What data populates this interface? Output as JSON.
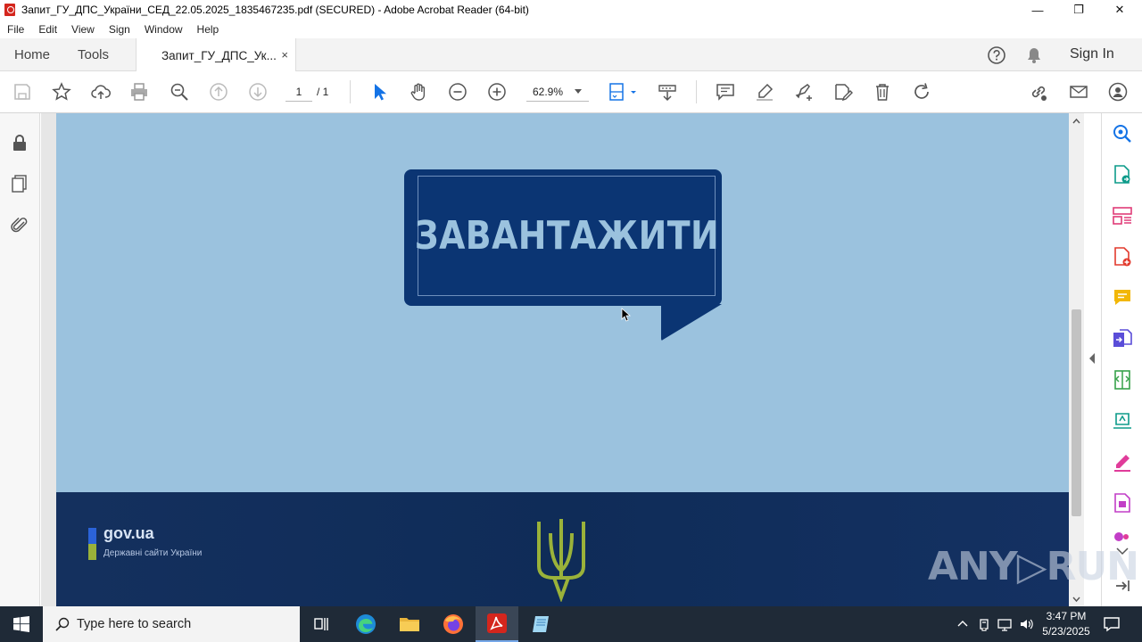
{
  "window": {
    "title": "Запит_ГУ_ДПС_України_СЕД_22.05.2025_1835467235.pdf (SECURED) - Adobe Acrobat Reader (64-bit)",
    "minimize": "—",
    "maximize": "❐",
    "close": "✕"
  },
  "menu": {
    "items": [
      "File",
      "Edit",
      "View",
      "Sign",
      "Window",
      "Help"
    ]
  },
  "tabs": {
    "home": "Home",
    "tools": "Tools",
    "document": "Запит_ГУ_ДПС_Ук...",
    "close": "×",
    "sign_in": "Sign In"
  },
  "toolbar": {
    "page_current": "1",
    "page_total": "/ 1",
    "zoom": "62.9%"
  },
  "document": {
    "button_text": "ЗАВАНТАЖИТИ",
    "gov_title": "gov.ua",
    "gov_subtitle": "Державні сайти України"
  },
  "watermark": "ANY▷RUN",
  "taskbar": {
    "search_placeholder": "Type here to search",
    "time": "3:47 PM",
    "date": "5/23/2025"
  },
  "colors": {
    "page_bg": "#9bc2de",
    "bubble": "#0b3573",
    "footer": "#14305e",
    "acrobat_red": "#d4261d",
    "accent_blue": "#1473e6"
  }
}
